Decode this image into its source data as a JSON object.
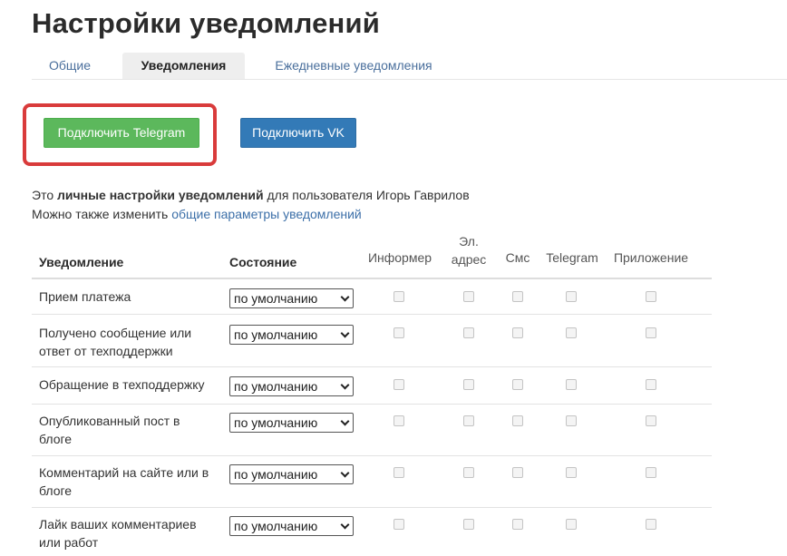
{
  "page": {
    "title": "Настройки уведомлений"
  },
  "tabs": [
    {
      "label": "Общие",
      "active": false
    },
    {
      "label": "Уведомления",
      "active": true
    },
    {
      "label": "Ежедневные уведомления",
      "active": false
    }
  ],
  "buttons": {
    "telegram_label": "Подключить Telegram",
    "vk_label": "Подключить VK"
  },
  "info": {
    "line1_prefix": "Это ",
    "line1_bold": "личные настройки уведомлений",
    "line1_suffix": " для пользователя Игорь Гаврилов",
    "line2_prefix": "Можно также изменить ",
    "line2_link": "общие параметры уведомлений"
  },
  "table": {
    "headers": {
      "notification": "Уведомление",
      "state": "Состояние",
      "informer": "Информер",
      "email_line1": "Эл.",
      "email_line2": "адрес",
      "sms": "Смс",
      "telegram": "Telegram",
      "app": "Приложение"
    },
    "rows": [
      {
        "label": "Прием платежа",
        "state": "по умолчанию"
      },
      {
        "label": "Получено сообщение или ответ от техподдержки",
        "state": "по умолчанию"
      },
      {
        "label": "Обращение в техподдержку",
        "state": "по умолчанию"
      },
      {
        "label": "Опубликованный пост в блоге",
        "state": "по умолчанию"
      },
      {
        "label": "Комментарий на сайте или в блоге",
        "state": "по умолчанию"
      },
      {
        "label": "Лайк ваших комментариев или работ",
        "state": "по умолчанию"
      }
    ]
  },
  "colors": {
    "highlight_border": "#d93b3b",
    "telegram_button": "#5cb85c",
    "vk_button": "#337ab7",
    "link": "#3c6fa8"
  }
}
